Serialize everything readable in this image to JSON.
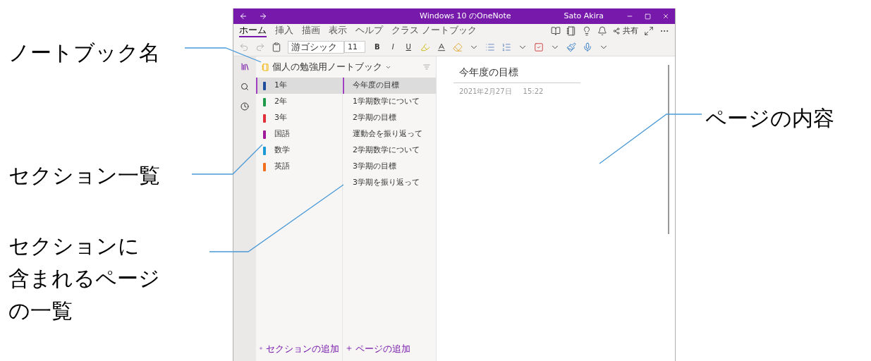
{
  "annotations": [
    {
      "kind": "notebook",
      "lines": [
        "ノートブック名"
      ]
    },
    {
      "kind": "sections",
      "lines": [
        "セクション一覧"
      ]
    },
    {
      "kind": "pages",
      "lines": [
        "セクションに",
        "含まれるページ",
        "の一覧"
      ]
    },
    {
      "kind": "content",
      "lines": [
        "ページの内容"
      ]
    }
  ],
  "window": {
    "title": "Windows 10 のOneNote",
    "user": "Sato Akira"
  },
  "ribbon_tabs": [
    {
      "label": "ホーム",
      "selected": true
    },
    {
      "label": "挿入",
      "selected": false
    },
    {
      "label": "描画",
      "selected": false
    },
    {
      "label": "表示",
      "selected": false
    },
    {
      "label": "ヘルプ",
      "selected": false
    },
    {
      "label": "クラス ノートブック",
      "selected": false
    }
  ],
  "share_label": "共有",
  "toolbar": {
    "font": "游ゴシック",
    "size": "11",
    "bold": "B",
    "italic": "I",
    "underline": "U"
  },
  "notebook": {
    "name": "個人の勉強用ノートブック"
  },
  "sections": [
    {
      "name": "1年",
      "color": "#1e4e9c",
      "selected": true
    },
    {
      "name": "2年",
      "color": "#1f9a48",
      "selected": false
    },
    {
      "name": "3年",
      "color": "#e0303a",
      "selected": false
    },
    {
      "name": "国語",
      "color": "#a0189c",
      "selected": false
    },
    {
      "name": "数学",
      "color": "#1c9ad6",
      "selected": false
    },
    {
      "name": "英語",
      "color": "#f07020",
      "selected": false
    }
  ],
  "pages": [
    {
      "title": "今年度の目標",
      "selected": true
    },
    {
      "title": "1学期数学について",
      "selected": false
    },
    {
      "title": "2学期の目標",
      "selected": false
    },
    {
      "title": "運動会を振り返って",
      "selected": false
    },
    {
      "title": "2学期数学について",
      "selected": false
    },
    {
      "title": "3学期の目標",
      "selected": false
    },
    {
      "title": "3学期を振り返って",
      "selected": false
    }
  ],
  "add_section": "セクションの追加",
  "add_page": "ページの追加",
  "page": {
    "title": "今年度の目標",
    "date": "2021年2月27日",
    "time": "15:22"
  }
}
